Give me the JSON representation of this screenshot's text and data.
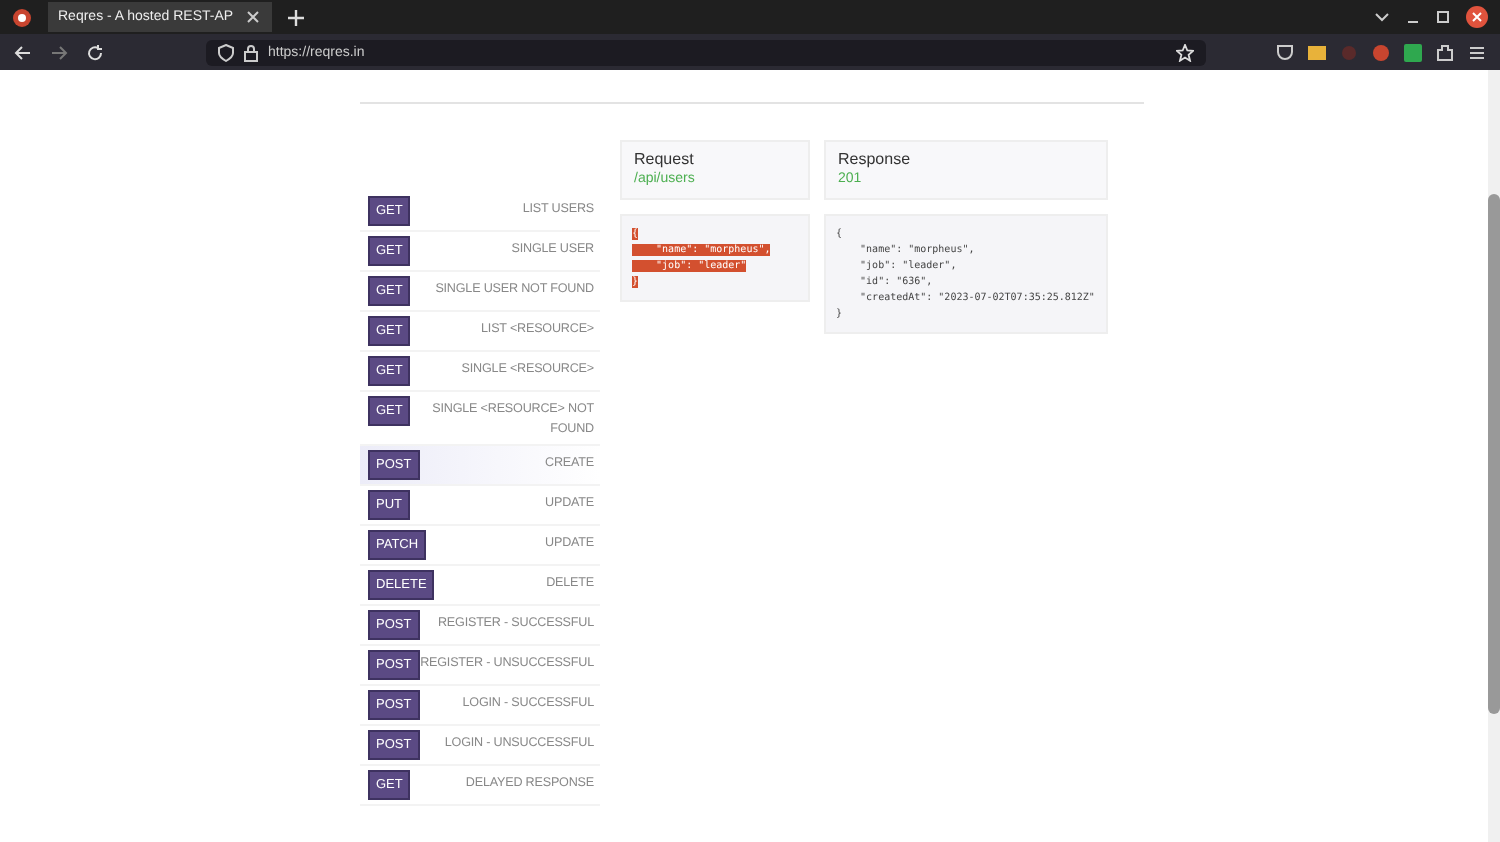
{
  "browser": {
    "tab_title": "Reqres - A hosted REST-AP",
    "address": "https://reqres.in"
  },
  "endpoints": [
    {
      "method": "GET",
      "label": "LIST USERS",
      "selected": false
    },
    {
      "method": "GET",
      "label": "SINGLE USER",
      "selected": false
    },
    {
      "method": "GET",
      "label": "SINGLE USER NOT FOUND",
      "selected": false
    },
    {
      "method": "GET",
      "label": "LIST <RESOURCE>",
      "selected": false
    },
    {
      "method": "GET",
      "label": "SINGLE <RESOURCE>",
      "selected": false
    },
    {
      "method": "GET",
      "label": "SINGLE <RESOURCE> NOT FOUND",
      "selected": false
    },
    {
      "method": "POST",
      "label": "CREATE",
      "selected": true
    },
    {
      "method": "PUT",
      "label": "UPDATE",
      "selected": false
    },
    {
      "method": "PATCH",
      "label": "UPDATE",
      "selected": false
    },
    {
      "method": "DELETE",
      "label": "DELETE",
      "selected": false
    },
    {
      "method": "POST",
      "label": "REGISTER - SUCCESSFUL",
      "selected": false
    },
    {
      "method": "POST",
      "label": "REGISTER - UNSUCCESSFUL",
      "selected": false
    },
    {
      "method": "POST",
      "label": "LOGIN - SUCCESSFUL",
      "selected": false
    },
    {
      "method": "POST",
      "label": "LOGIN - UNSUCCESSFUL",
      "selected": false
    },
    {
      "method": "GET",
      "label": "DELAYED RESPONSE",
      "selected": false
    }
  ],
  "request": {
    "title": "Request",
    "path": "/api/users",
    "highlighted": true,
    "body": [
      "{",
      "    \"name\": \"morpheus\",",
      "    \"job\": \"leader\"",
      "}"
    ]
  },
  "response": {
    "title": "Response",
    "status": "201",
    "body": [
      "{",
      "    \"name\": \"morpheus\",",
      "    \"job\": \"leader\",",
      "    \"id\": \"636\",",
      "    \"createdAt\": \"2023-07-02T07:35:25.812Z\"",
      "}"
    ]
  }
}
